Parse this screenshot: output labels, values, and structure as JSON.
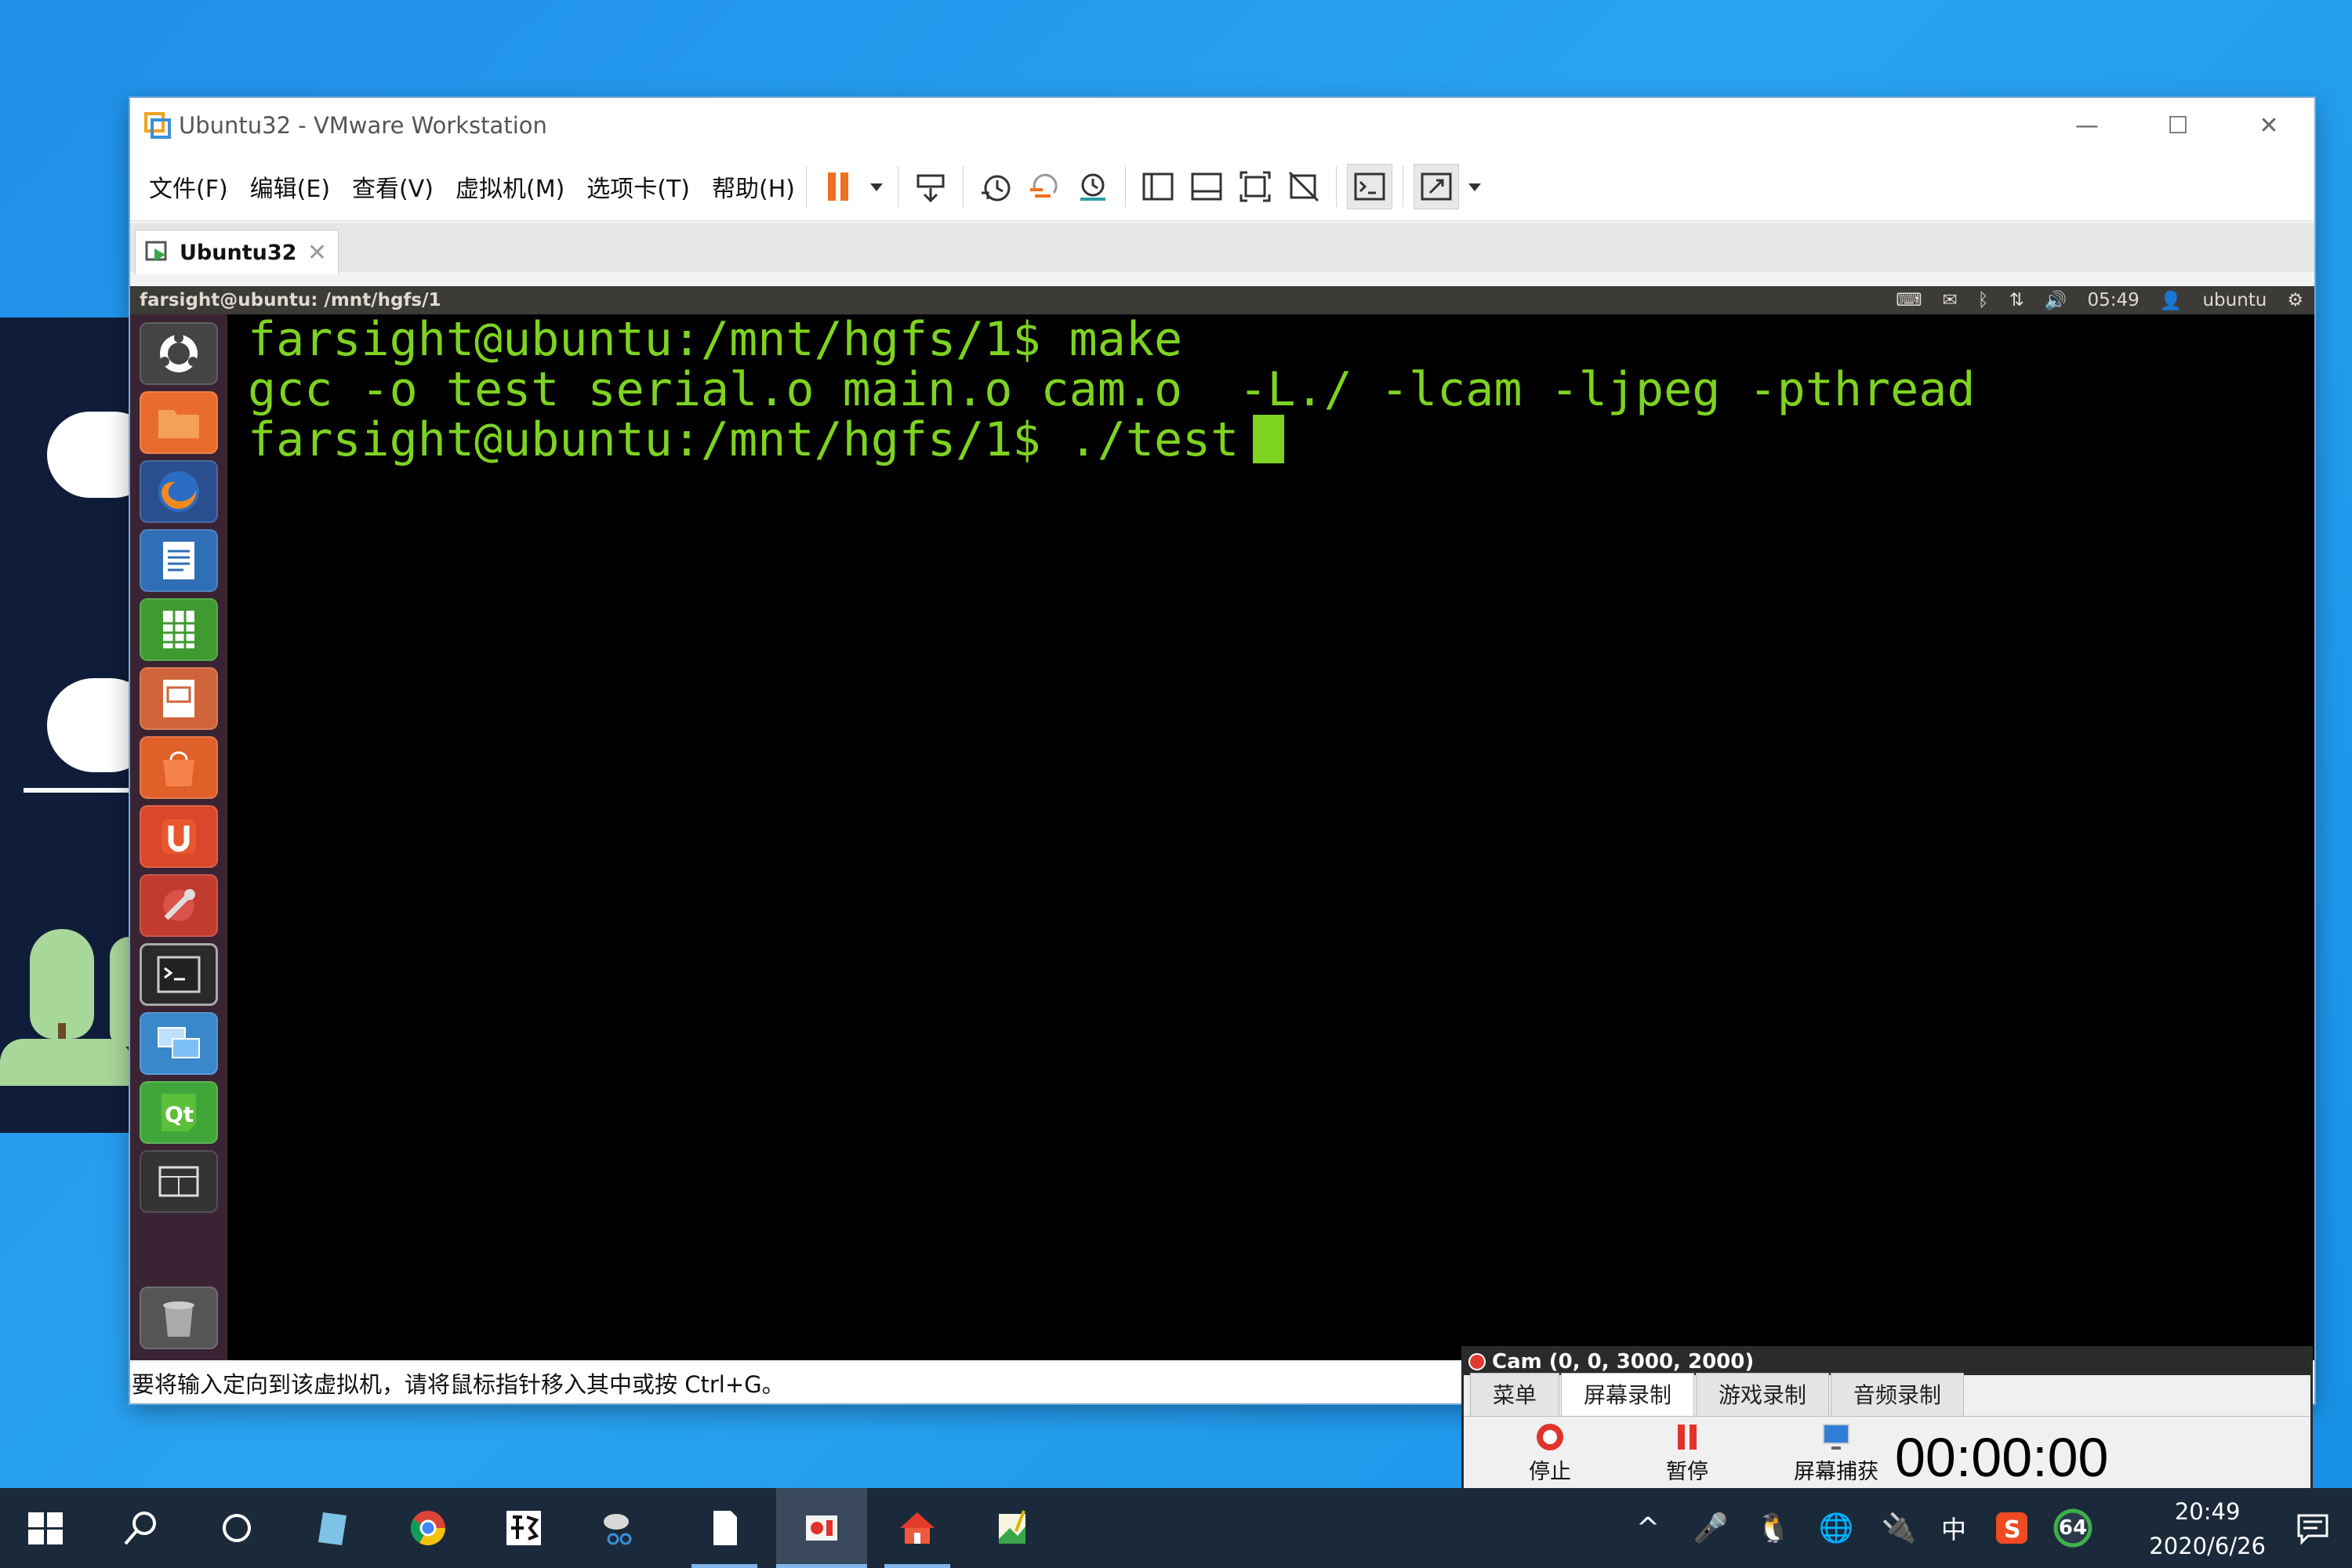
{
  "window": {
    "title": "Ubuntu32 - VMware Workstation",
    "controls": {
      "minimize": "—",
      "maximize": "☐",
      "close": "✕"
    }
  },
  "menu": {
    "items": [
      "文件(F)",
      "编辑(E)",
      "查看(V)",
      "虚拟机(M)",
      "选项卡(T)",
      "帮助(H)"
    ]
  },
  "toolbar": {
    "icons": [
      "pause-icon",
      "dropdown-icon",
      "send-ctrl-alt-del-icon",
      "snapshot-icon",
      "revert-snapshot-icon",
      "snapshot-manager-icon",
      "library-view-icon",
      "thumbnail-bar-icon",
      "fullscreen-icon",
      "unity-icon",
      "console-view-icon",
      "stretch-guest-icon"
    ]
  },
  "tabs": [
    {
      "label": "Ubuntu32",
      "close": "✕"
    }
  ],
  "guest": {
    "panel_title": "farsight@ubuntu: /mnt/hgfs/1",
    "tray": {
      "time": "05:49",
      "user": "ubuntu"
    },
    "terminal_lines": [
      "farsight@ubuntu:/mnt/hgfs/1$ make",
      "gcc -o test serial.o main.o cam.o  -L./ -lcam -ljpeg -pthread",
      "farsight@ubuntu:/mnt/hgfs/1$ ./test"
    ],
    "colors": {
      "terminal_fg": "#7ed321",
      "terminal_bg": "#000000",
      "launcher_bg": "#3a2433"
    }
  },
  "status_message": "要将输入定向到该虚拟机，请将鼠标指针移入其中或按 Ctrl+G。",
  "ocam": {
    "title": "Cam (0, 0, 3000, 2000)",
    "tabs": [
      "菜单",
      "屏幕录制",
      "游戏录制",
      "音频录制"
    ],
    "actions": [
      "停止",
      "暂停",
      "屏幕捕获"
    ],
    "timer": "00:00:00"
  },
  "taskbar": {
    "clock_time": "20:49",
    "clock_date": "2020/6/26",
    "ime": "中",
    "badge": "64"
  }
}
